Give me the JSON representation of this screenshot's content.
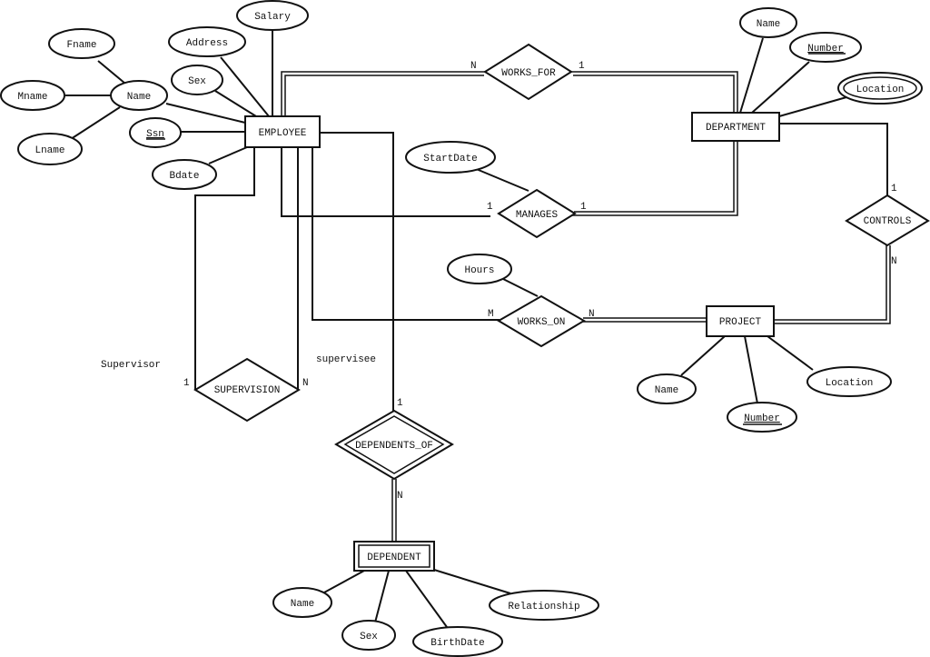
{
  "diagram": {
    "type": "ER diagram",
    "entities": [
      {
        "id": "employee",
        "label": "EMPLOYEE",
        "weak": false
      },
      {
        "id": "department",
        "label": "DEPARTMENT",
        "weak": false
      },
      {
        "id": "project",
        "label": "PROJECT",
        "weak": false
      },
      {
        "id": "dependent",
        "label": "DEPENDENT",
        "weak": true
      }
    ],
    "relationships": [
      {
        "id": "works_for",
        "label": "WORKS_FOR",
        "identifying": false
      },
      {
        "id": "manages",
        "label": "MANAGES",
        "identifying": false
      },
      {
        "id": "works_on",
        "label": "WORKS_ON",
        "identifying": false
      },
      {
        "id": "controls",
        "label": "CONTROLS",
        "identifying": false
      },
      {
        "id": "supervision",
        "label": "SUPERVISION",
        "identifying": false
      },
      {
        "id": "dependents_of",
        "label": "DEPENDENTS_OF",
        "identifying": true
      }
    ],
    "attributes": [
      {
        "id": "emp_fname",
        "label": "Fname",
        "key": false,
        "multivalued": false
      },
      {
        "id": "emp_mname",
        "label": "Mname",
        "key": false,
        "multivalued": false
      },
      {
        "id": "emp_lname",
        "label": "Lname",
        "key": false,
        "multivalued": false
      },
      {
        "id": "emp_name",
        "label": "Name",
        "key": false,
        "multivalued": false
      },
      {
        "id": "emp_ssn",
        "label": "Ssn",
        "key": true,
        "multivalued": false
      },
      {
        "id": "emp_bdate",
        "label": "Bdate",
        "key": false,
        "multivalued": false
      },
      {
        "id": "emp_sex",
        "label": "Sex",
        "key": false,
        "multivalued": false
      },
      {
        "id": "emp_address",
        "label": "Address",
        "key": false,
        "multivalued": false
      },
      {
        "id": "emp_salary",
        "label": "Salary",
        "key": false,
        "multivalued": false
      },
      {
        "id": "dept_name",
        "label": "Name",
        "key": false,
        "multivalued": false
      },
      {
        "id": "dept_number",
        "label": "Number",
        "key": true,
        "multivalued": false
      },
      {
        "id": "dept_location",
        "label": "Location",
        "key": false,
        "multivalued": true
      },
      {
        "id": "startdate",
        "label": "StartDate",
        "key": false,
        "multivalued": false
      },
      {
        "id": "hours",
        "label": "Hours",
        "key": false,
        "multivalued": false
      },
      {
        "id": "proj_name",
        "label": "Name",
        "key": false,
        "multivalued": false
      },
      {
        "id": "proj_number",
        "label": "Number",
        "key": true,
        "multivalued": false
      },
      {
        "id": "proj_location",
        "label": "Location",
        "key": false,
        "multivalued": false
      },
      {
        "id": "dep_name",
        "label": "Name",
        "key": false,
        "multivalued": false
      },
      {
        "id": "dep_sex",
        "label": "Sex",
        "key": false,
        "multivalued": false
      },
      {
        "id": "dep_birthdate",
        "label": "BirthDate",
        "key": false,
        "multivalued": false
      },
      {
        "id": "dep_relationship",
        "label": "Relationship",
        "key": false,
        "multivalued": false
      }
    ],
    "cardinalities": {
      "works_for_emp": "N",
      "works_for_dept": "1",
      "manages_emp": "1",
      "manages_dept": "1",
      "works_on_emp": "M",
      "works_on_proj": "N",
      "controls_dept": "1",
      "controls_proj": "N",
      "supervision_supervisor": "1",
      "supervision_supervisee": "N",
      "dependents_of_emp": "1",
      "dependents_of_dep": "N"
    },
    "roles": {
      "supervisor": "Supervisor",
      "supervisee": "supervisee"
    }
  }
}
